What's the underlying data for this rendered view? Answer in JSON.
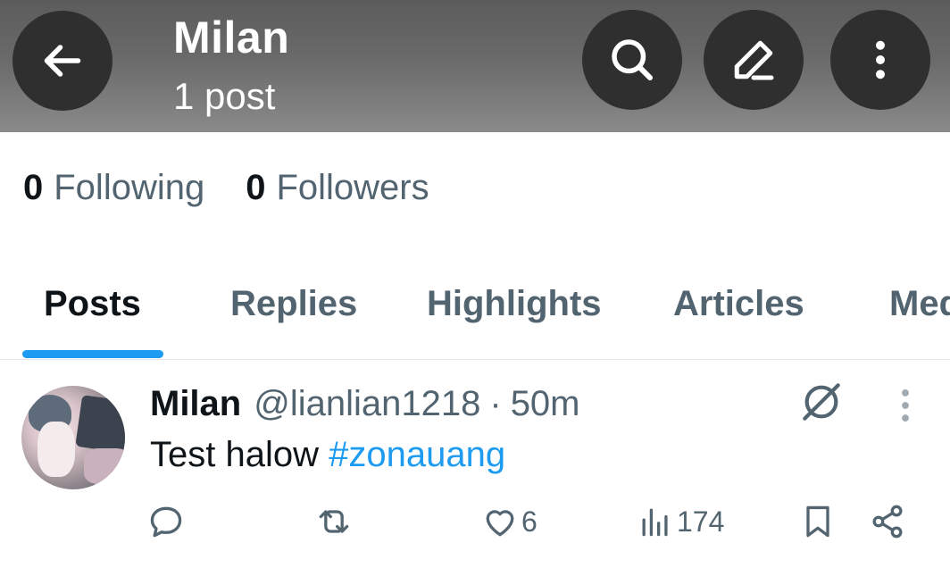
{
  "header": {
    "title": "Milan",
    "subtitle": "1 post",
    "icons": [
      "back-arrow-icon",
      "search-icon",
      "edit-icon",
      "more-vertical-icon"
    ]
  },
  "stats": {
    "following_count": "0",
    "following_label": "Following",
    "followers_count": "0",
    "followers_label": "Followers"
  },
  "tabs": [
    {
      "label": "Posts",
      "active": true
    },
    {
      "label": "Replies",
      "active": false
    },
    {
      "label": "Highlights",
      "active": false
    },
    {
      "label": "Articles",
      "active": false
    },
    {
      "label": "Media",
      "active": false
    }
  ],
  "post": {
    "name": "Milan",
    "handle": "@lianlian1218",
    "separator": "·",
    "time": "50m",
    "text": "Test halow ",
    "hashtag": "#zonauang",
    "likes": "6",
    "views": "174"
  },
  "colors": {
    "accent": "#1d9bf0",
    "text_primary": "#0f1419",
    "text_secondary": "#536471"
  }
}
